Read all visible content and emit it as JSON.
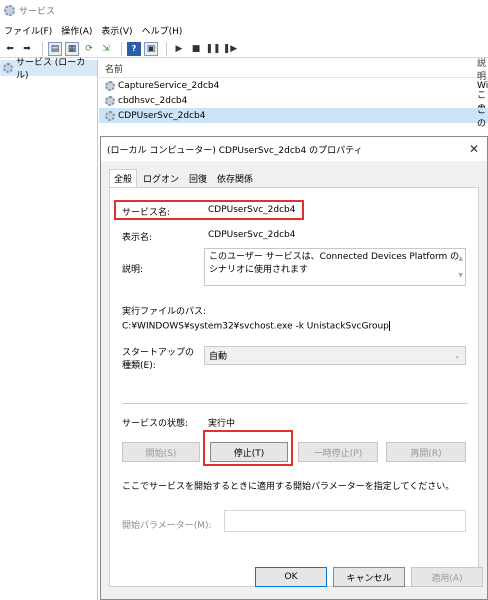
{
  "window": {
    "title": "サービス"
  },
  "menu": [
    "ファイル(F)",
    "操作(A)",
    "表示(V)",
    "ヘルプ(H)"
  ],
  "toolbar": {
    "buttons": [
      "back-arrow-icon",
      "forward-arrow-icon",
      "console-tree-icon",
      "properties-list-icon",
      "refresh-icon",
      "export-icon",
      "help-icon",
      "view-icon",
      "play-icon",
      "stop-icon",
      "pause-icon",
      "restart-icon"
    ]
  },
  "tree": {
    "item_label": "サービス (ローカル)"
  },
  "list": {
    "col_name": "名前",
    "col_desc": "説明",
    "rows": [
      {
        "name": "CaptureService_2dcb4",
        "desc": "Wi"
      },
      {
        "name": "cbdhsvc_2dcb4",
        "desc": "この"
      },
      {
        "name": "CDPUserSvc_2dcb4",
        "desc": "この"
      }
    ]
  },
  "dialog": {
    "title": "(ローカル コンピューター) CDPUserSvc_2dcb4 のプロパティ",
    "close_glyph": "✕",
    "tabs": [
      "全般",
      "ログオン",
      "回復",
      "依存関係"
    ],
    "service_name_label": "サービス名:",
    "service_name_value": "CDPUserSvc_2dcb4",
    "display_name_label": "表示名:",
    "display_name_value": "CDPUserSvc_2dcb4",
    "description_label": "説明:",
    "description_value": "このユーザー サービスは、Connected Devices Platform のシナリオに使用されます",
    "path_label": "実行ファイルのパス:",
    "path_value": "C:¥WINDOWS¥system32¥svchost.exe -k UnistackSvcGroup",
    "startup_label_line1": "スタートアップの",
    "startup_label_line2": "種類(E):",
    "startup_value": "自動",
    "status_label": "サービスの状態:",
    "status_value": "実行中",
    "buttons": {
      "start": "開始(S)",
      "stop": "停止(T)",
      "pause": "一時停止(P)",
      "resume": "再開(R)"
    },
    "hint": "ここでサービスを開始するときに適用する開始パラメーターを指定してください。",
    "param_label": "開始パラメーター(M):",
    "param_value": "",
    "footer": {
      "ok": "OK",
      "cancel": "キャンセル",
      "apply": "適用(A)"
    }
  },
  "colors": {
    "highlight_border": "#e03030",
    "selection": "#cce4f7",
    "focus_border": "#0078d7"
  }
}
